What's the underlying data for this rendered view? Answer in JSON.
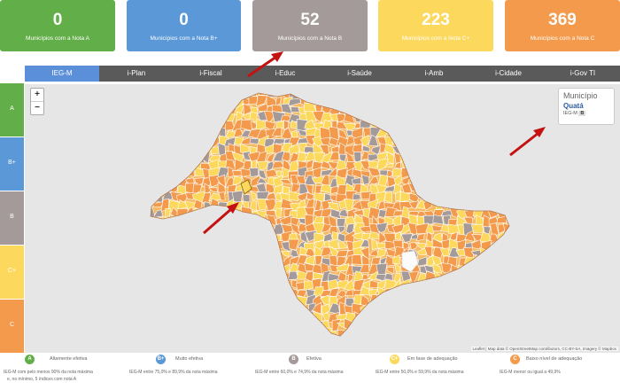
{
  "colors": {
    "A": "#62ae48",
    "B+": "#5a98d8",
    "B": "#a49a9a",
    "C+": "#fcd85d",
    "C": "#f39a4c",
    "tab_bg": "#5a5a5a",
    "tab_active": "#5b8fd9",
    "arrow": "#c41212",
    "unfilled": "#fbfbfb"
  },
  "summary": [
    {
      "grade": "A",
      "count": "0",
      "caption": "Municípios com a Nota A"
    },
    {
      "grade": "B+",
      "count": "0",
      "caption": "Municípios com a Nota B+"
    },
    {
      "grade": "B",
      "count": "52",
      "caption": "Municípios com a Nota B"
    },
    {
      "grade": "C+",
      "count": "223",
      "caption": "Municípios com a Nota C+"
    },
    {
      "grade": "C",
      "count": "369",
      "caption": "Municípios com a Nota C"
    }
  ],
  "tabs": [
    "IEG-M",
    "i-Plan",
    "i-Fiscal",
    "i-Educ",
    "i-Saúde",
    "i-Amb",
    "i-Cidade",
    "i-Gov TI"
  ],
  "active_tab": 0,
  "sidebar": [
    "A",
    "B+",
    "B",
    "C+",
    "C"
  ],
  "map": {
    "zoom_in": "+",
    "zoom_out": "−",
    "info": {
      "title": "Município",
      "name": "Quatá",
      "index_label": "IEG-M",
      "grade": "B"
    },
    "attribution": "Leaflet | Map data © OpenStreetMap contributors, CC-BY-SA, Imagery © Mapbox",
    "icons": [
      "red-arrow-icon"
    ]
  },
  "legend": [
    {
      "grade": "A",
      "label": "Altamente efetiva",
      "desc_1": "IEG-M com pelo menos 90% da nota máxima",
      "desc_2": "e, no mínimo, 5 índices com nota A"
    },
    {
      "grade": "B+",
      "label": "Muito efetiva",
      "desc_1": "IEG-M entre 75,0% e 89,9% da nota máxima",
      "desc_2": ""
    },
    {
      "grade": "B",
      "label": "Efetiva",
      "desc_1": "IEG-M entre 60,0% e 74,9% da nota máxima",
      "desc_2": ""
    },
    {
      "grade": "C+",
      "label": "Em fase de adequação",
      "desc_1": "IEG-M entre 50,0% e 59,9% da nota máxima",
      "desc_2": ""
    },
    {
      "grade": "C",
      "label": "Baixo nível de adequação",
      "desc_1": "IEG-M menor ou igual a 49,9%",
      "desc_2": ""
    }
  ]
}
